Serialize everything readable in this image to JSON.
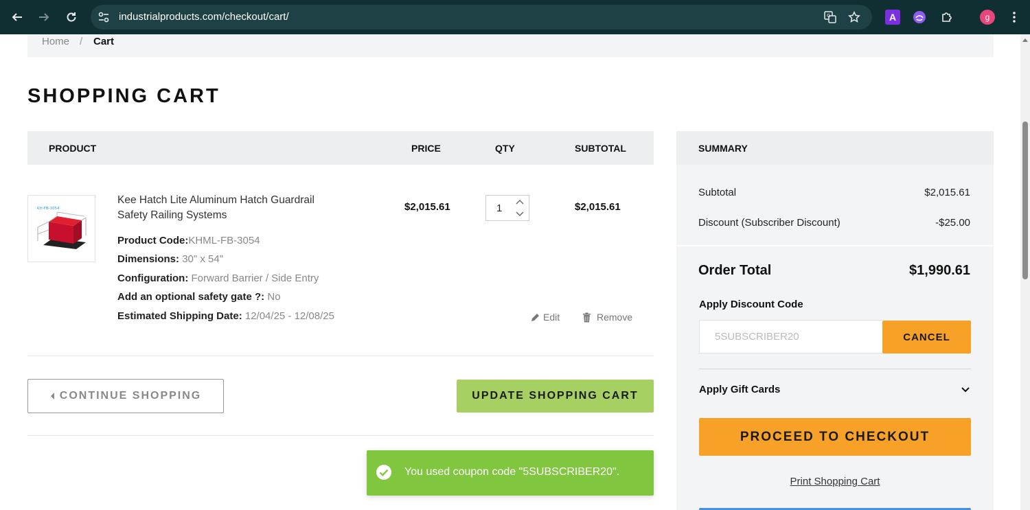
{
  "browser": {
    "url": "industrialproducts.com/checkout/cart/",
    "profile_initial": "g",
    "colors": {
      "frame": "#0f2f33",
      "url_bar": "#1d4145",
      "profile": "#e8457a",
      "ext_a": "#8a2be2"
    }
  },
  "breadcrumb": {
    "home": "Home",
    "separator": "/",
    "current": "Cart"
  },
  "page": {
    "title": "SHOPPING CART"
  },
  "table": {
    "headers": {
      "product": "PRODUCT",
      "price": "PRICE",
      "qty": "QTY",
      "subtotal": "SUBTOTAL"
    }
  },
  "item": {
    "image_label": "KH-FB-3054",
    "name": "Kee Hatch Lite Aluminum Hatch Guardrail Safety Railing Systems",
    "attributes": [
      {
        "label": "Product Code:",
        "value": "KHML-FB-3054"
      },
      {
        "label": "Dimensions:",
        "value": "30\" x 54\""
      },
      {
        "label": "Configuration:",
        "value": "Forward Barrier / Side Entry"
      },
      {
        "label": "Add an optional safety gate ?:",
        "value": "No"
      },
      {
        "label": "Estimated Shipping Date:",
        "value": "12/04/25 - 12/08/25"
      }
    ],
    "price": "$2,015.61",
    "qty": "1",
    "subtotal": "$2,015.61",
    "edit_label": "Edit",
    "remove_label": "Remove"
  },
  "buttons": {
    "continue": "CONTINUE SHOPPING",
    "update": "UPDATE SHOPPING CART"
  },
  "toast": {
    "message": "You used coupon code \"5SUBSCRIBER20\"."
  },
  "summary": {
    "title": "SUMMARY",
    "subtotal_label": "Subtotal",
    "subtotal_value": "$2,015.61",
    "discount_label": "Discount (Subscriber Discount)",
    "discount_value": "-$25.00",
    "order_total_label": "Order Total",
    "order_total_value": "$1,990.61",
    "discount_code_label": "Apply Discount Code",
    "discount_code_value": "5SUBSCRIBER20",
    "cancel_label": "CANCEL",
    "gift_cards_label": "Apply Gift Cards",
    "checkout_label": "PROCEED TO CHECKOUT",
    "print_label": "Print Shopping Cart"
  },
  "colors": {
    "accent_orange": "#f7a128",
    "accent_green": "#a7d063",
    "toast_green": "#80c63e"
  }
}
